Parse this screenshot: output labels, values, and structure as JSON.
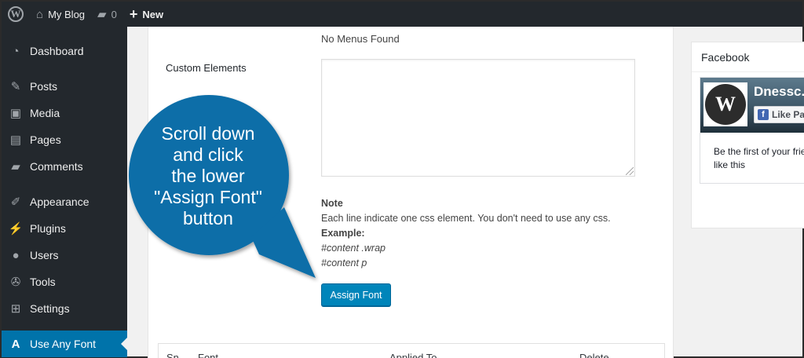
{
  "adminbar": {
    "site_name": "My Blog",
    "comments_count": "0",
    "new_label": "New"
  },
  "sidebar": {
    "items": [
      {
        "label": "Dashboard",
        "icon": "dashboard-icon"
      },
      {
        "label": "Posts",
        "icon": "pushpin-icon"
      },
      {
        "label": "Media",
        "icon": "media-icon"
      },
      {
        "label": "Pages",
        "icon": "pages-icon"
      },
      {
        "label": "Comments",
        "icon": "comment-icon"
      },
      {
        "label": "Appearance",
        "icon": "paintbrush-icon"
      },
      {
        "label": "Plugins",
        "icon": "plugin-icon"
      },
      {
        "label": "Users",
        "icon": "user-icon"
      },
      {
        "label": "Tools",
        "icon": "wrench-icon"
      },
      {
        "label": "Settings",
        "icon": "settings-icon"
      },
      {
        "label": "Use Any Font",
        "icon": "font-a-icon",
        "current": true
      }
    ]
  },
  "main": {
    "no_menus": "No Menus Found",
    "custom_elements_label": "Custom Elements",
    "custom_elements_value": "",
    "note_title": "Note",
    "note_text": "Each line indicate one css element. You don't need to use any css.",
    "example_label": "Example:",
    "example_lines": [
      "#content .wrap",
      "#content p"
    ],
    "assign_button": "Assign Font",
    "table_headers": [
      "Sn",
      "Font",
      "Applied To",
      "Delete"
    ]
  },
  "callout": {
    "lines": [
      "Scroll down",
      "and click",
      "the lower",
      "\"Assign Font\"",
      "button"
    ],
    "color": "#0f6ea8"
  },
  "widget": {
    "title": "Facebook",
    "fb_page_name": "Dnessc.",
    "fb_like_label": "Like Pa",
    "fb_text_line1": "Be the first of your frie",
    "fb_text_line2": "like this"
  },
  "colors": {
    "admin_bg": "#23282d",
    "accent": "#0073aa",
    "button": "#0085ba"
  }
}
